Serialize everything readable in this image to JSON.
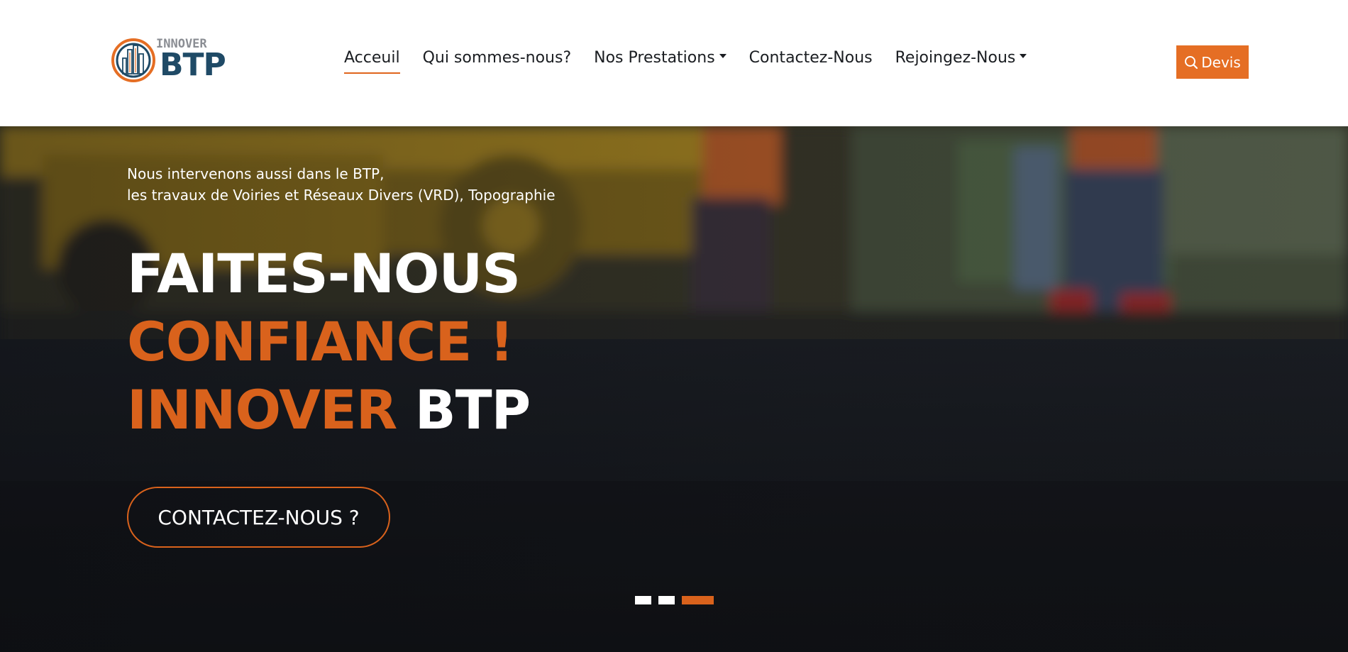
{
  "brand": {
    "logo_top": "INNOVER",
    "logo_main": "BTP",
    "accent_color": "#e56e24",
    "dark_color": "#1f4a66"
  },
  "nav": {
    "items": [
      {
        "label": "Acceuil",
        "active": true,
        "dropdown": false
      },
      {
        "label": "Qui sommes-nous?",
        "active": false,
        "dropdown": false
      },
      {
        "label": "Nos Prestations",
        "active": false,
        "dropdown": true
      },
      {
        "label": "Contactez-Nous",
        "active": false,
        "dropdown": false
      },
      {
        "label": "Rejoingez-Nous",
        "active": false,
        "dropdown": true
      }
    ],
    "devis_label": "Devis",
    "devis_icon": "search-icon"
  },
  "hero": {
    "subtitle_line1": "Nous intervenons aussi dans le BTP,",
    "subtitle_line2": "les travaux de Voiries et Réseaux Divers (VRD), Topographie",
    "title_line1": "FAITES-NOUS",
    "title_line2": "CONFIANCE !",
    "title_line3_orange": "INNOVER",
    "title_line3_white": "BTP",
    "cta_label": "CONTACTEZ-NOUS ?"
  },
  "carousel": {
    "slide_count": 3,
    "active_index": 2
  }
}
